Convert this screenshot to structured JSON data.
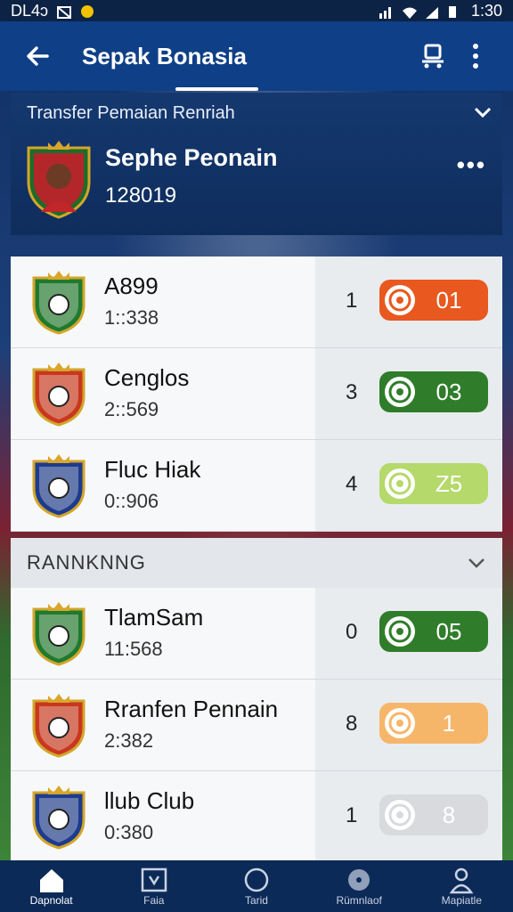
{
  "status": {
    "left_text": "DL4ɔ",
    "time": "1:30"
  },
  "appbar": {
    "title": "Sepak Bonasia"
  },
  "header_card": {
    "subtitle": "Transfer Pemaian Renriah",
    "player_name": "Sephe Peonain",
    "player_number": "128019",
    "more": "•••"
  },
  "transfers": [
    {
      "name": "A899",
      "time": "1::338",
      "rank": "1",
      "value": "01",
      "pill_color": "#e8581f",
      "crest_color": "#1f7a2e"
    },
    {
      "name": "Cenglos",
      "time": "2::569",
      "rank": "3",
      "value": "03",
      "pill_color": "#2f7d2a",
      "crest_color": "#c9371e"
    },
    {
      "name": "Fluc Hiak",
      "time": "0::906",
      "rank": "4",
      "value": "Z5",
      "pill_color": "#b5d96a",
      "crest_color": "#1d3b8f"
    }
  ],
  "ranking": {
    "label": "RANNKNNG",
    "rows": [
      {
        "name": "TlamSam",
        "time": "11:568",
        "rank": "0",
        "value": "05",
        "pill_color": "#2f7d2a",
        "crest_color": "#1f7a2e"
      },
      {
        "name": "Rranfen Pennain",
        "time": "2:382",
        "rank": "8",
        "value": "1",
        "pill_color": "#f6b66a",
        "crest_color": "#c9371e"
      },
      {
        "name": "llub Club",
        "time": "0:380",
        "rank": "1",
        "value": "8",
        "pill_color": "#d8dadd",
        "crest_color": "#1d3b8f"
      }
    ]
  },
  "bottom_nav": [
    {
      "label": "Dapnolat",
      "icon": "home-icon"
    },
    {
      "label": "Faia",
      "icon": "tv-icon"
    },
    {
      "label": "Tarid",
      "icon": "circle-icon"
    },
    {
      "label": "Rümnlaof",
      "icon": "disc-icon"
    },
    {
      "label": "Mapiatle",
      "icon": "person-icon"
    }
  ]
}
